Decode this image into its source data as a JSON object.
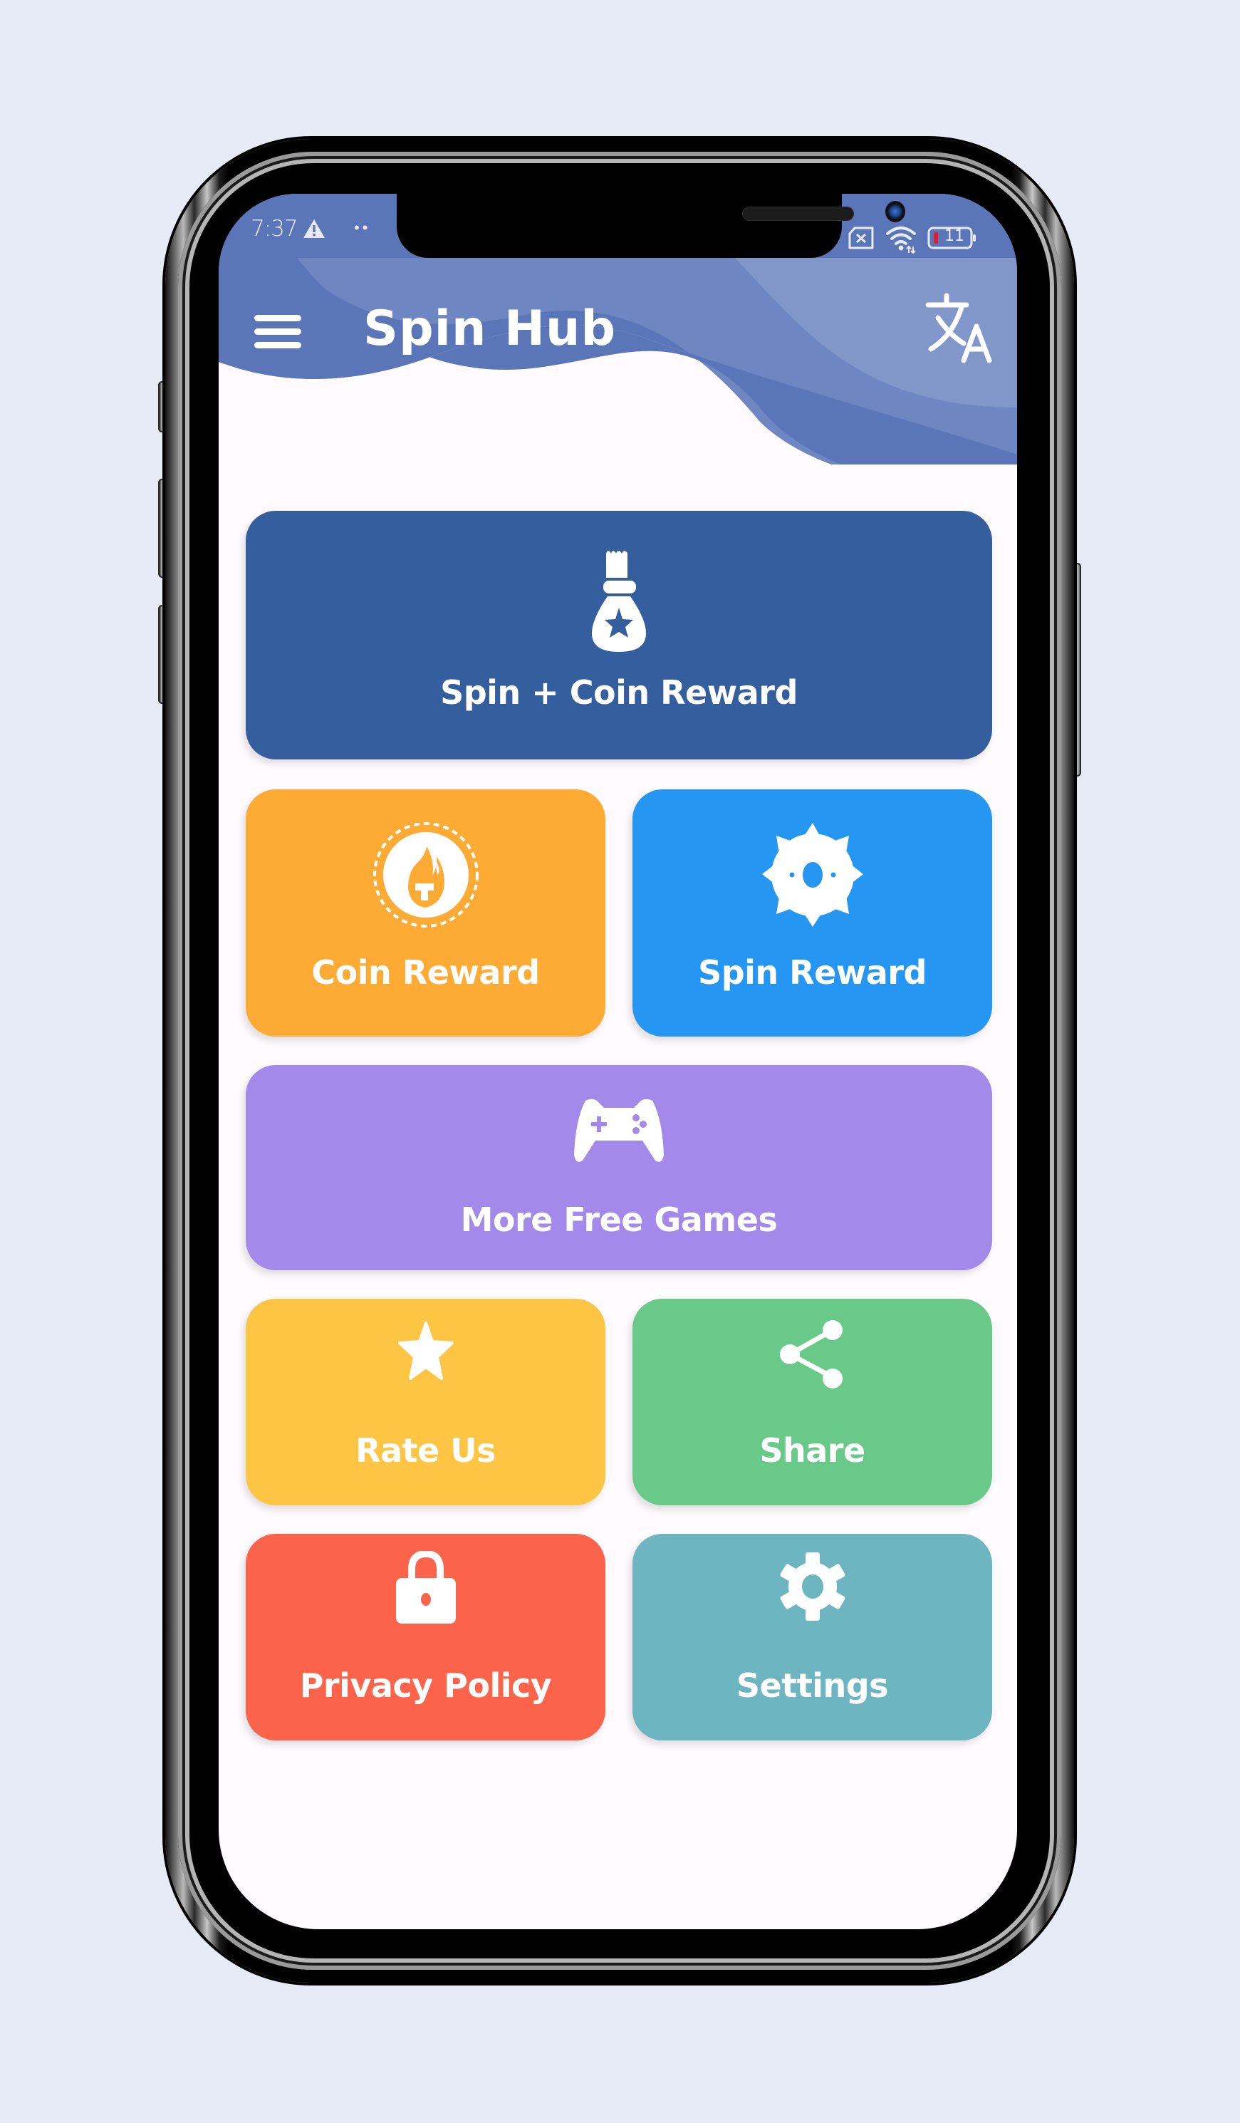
{
  "status_bar": {
    "time": "7:37",
    "dots": "••",
    "battery_level": "11",
    "icons": [
      "warning-icon",
      "no-sim-icon",
      "wifi-icon",
      "battery-icon"
    ]
  },
  "app_bar": {
    "title": "Spin Hub",
    "menu_icon": "hamburger-menu-icon",
    "translate_icon": "translate-icon"
  },
  "colors": {
    "header_blue": "#5a76b9",
    "background": "#fffbfe",
    "page_background": "#e7ebf5"
  },
  "cards": [
    {
      "id": "spin-coin",
      "label": "Spin + Coin Reward",
      "icon": "money-bag-star-icon",
      "color": "#355e9f"
    },
    {
      "id": "coin",
      "label": "Coin Reward",
      "icon": "coin-flame-icon",
      "color": "#feab35"
    },
    {
      "id": "spin",
      "label": "Spin Reward",
      "icon": "spin-wheel-icon",
      "color": "#2597f2"
    },
    {
      "id": "games",
      "label": "More Free Games",
      "icon": "gamepad-icon",
      "color": "#a38aea"
    },
    {
      "id": "rate",
      "label": "Rate Us",
      "icon": "star-icon",
      "color": "#fec443"
    },
    {
      "id": "share",
      "label": "Share",
      "icon": "share-icon",
      "color": "#69c989"
    },
    {
      "id": "privacy",
      "label": "Privacy Policy",
      "icon": "lock-icon",
      "color": "#fc634b"
    },
    {
      "id": "settings",
      "label": "Settings",
      "icon": "gear-icon",
      "color": "#6db5c0"
    }
  ]
}
